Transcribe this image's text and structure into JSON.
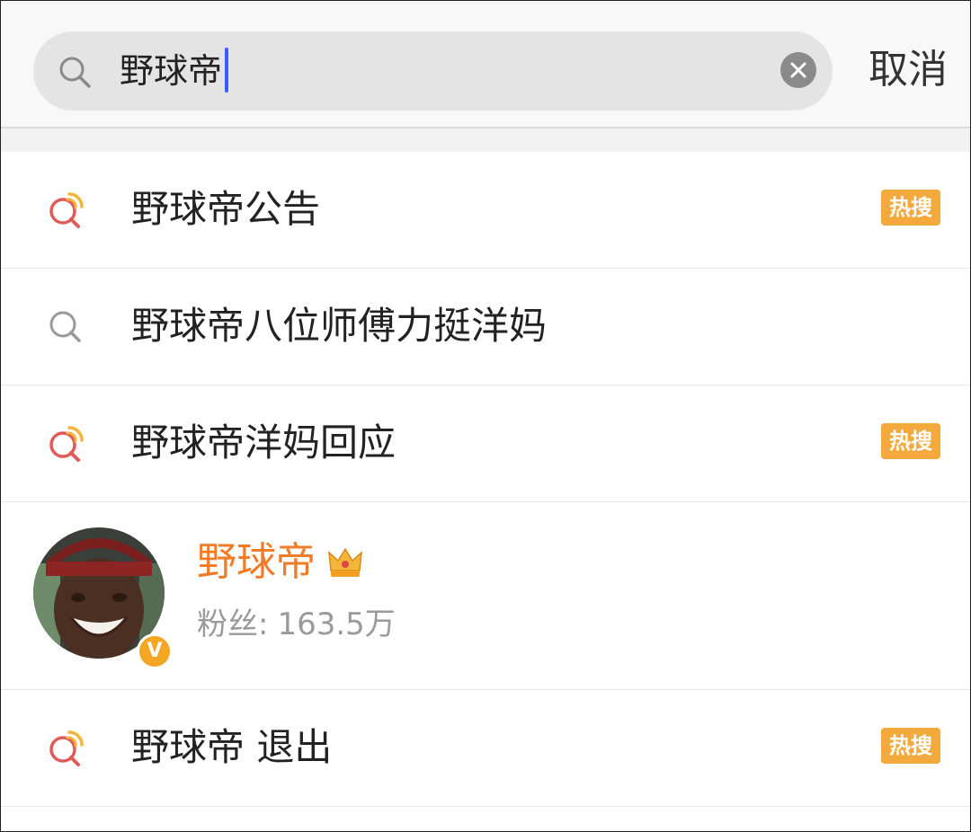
{
  "search": {
    "query": "野球帝",
    "cancel_label": "取消"
  },
  "results": [
    {
      "type": "hot",
      "label": "野球帝公告",
      "badge": "热搜"
    },
    {
      "type": "plain",
      "label": "野球帝八位师傅力挺洋妈"
    },
    {
      "type": "hot",
      "label": "野球帝洋妈回应",
      "badge": "热搜"
    },
    {
      "type": "user",
      "name": "野球帝",
      "fans_label": "粉丝:",
      "fans_value": "163.5万"
    },
    {
      "type": "hot",
      "label": "野球帝 退出",
      "badge": "热搜"
    }
  ],
  "icons": {
    "search": "search-icon",
    "clear": "clear-icon",
    "hot_search": "hot-search-icon",
    "crown": "crown-icon",
    "verified": "verified-icon"
  },
  "colors": {
    "accent_orange": "#f07b28",
    "badge_orange": "#f3a93b",
    "caret_blue": "#3d5afe"
  }
}
